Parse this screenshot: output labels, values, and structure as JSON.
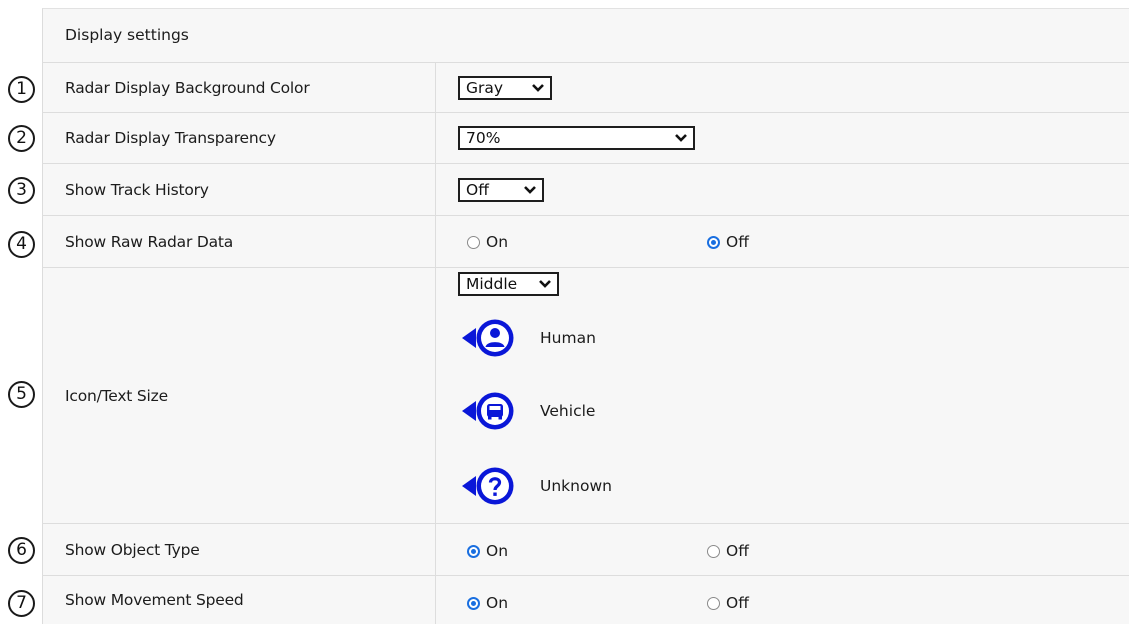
{
  "section": {
    "title": "Display settings"
  },
  "rows": [
    {
      "number": "1",
      "label": "Radar Display Background Color",
      "select_value": "Gray"
    },
    {
      "number": "2",
      "label": "Radar Display Transparency",
      "select_value": "70%"
    },
    {
      "number": "3",
      "label": "Show Track History",
      "select_value": "Off"
    },
    {
      "number": "4",
      "label": "Show Raw Radar Data",
      "options": [
        "On",
        "Off"
      ],
      "selected": "Off"
    },
    {
      "number": "5",
      "label": "Icon/Text Size",
      "select_value": "Middle",
      "legend": [
        {
          "icon": "human-icon",
          "label": "Human"
        },
        {
          "icon": "vehicle-icon",
          "label": "Vehicle"
        },
        {
          "icon": "unknown-icon",
          "label": "Unknown"
        }
      ]
    },
    {
      "number": "6",
      "label": "Show Object Type",
      "options": [
        "On",
        "Off"
      ],
      "selected": "On"
    },
    {
      "number": "7",
      "label": "Show Movement Speed",
      "options": [
        "On",
        "Off"
      ],
      "selected": "On"
    }
  ],
  "colors": {
    "icon_blue": "#0a17d8",
    "radio_accent": "#1a6fe0"
  }
}
